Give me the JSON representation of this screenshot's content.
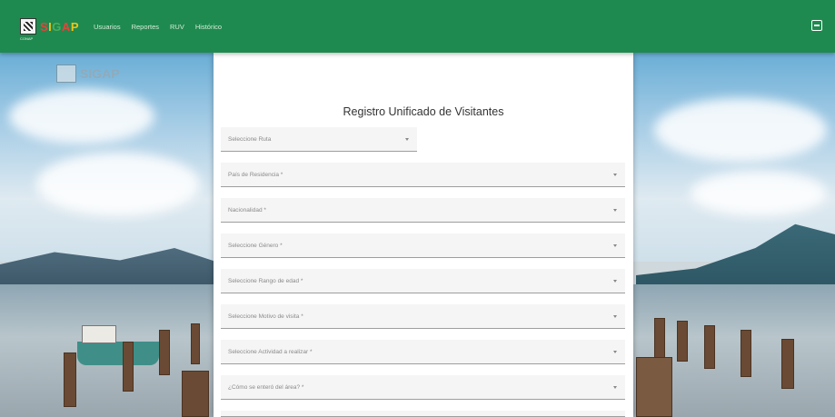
{
  "header": {
    "brand": "SIGAP",
    "subbrand": "CONAP",
    "nav": [
      {
        "label": "Usuarios"
      },
      {
        "label": "Reportes"
      },
      {
        "label": "RUV"
      },
      {
        "label": "Histórico"
      }
    ]
  },
  "background_logo": "SIGAP",
  "form": {
    "title": "Registro Unificado de Visitantes",
    "fields": [
      {
        "label": "Seleccione Ruta"
      },
      {
        "label": "País de Residencia *"
      },
      {
        "label": "Nacionalidad *"
      },
      {
        "label": "Seleccione Género *"
      },
      {
        "label": "Seleccione Rango de edad *"
      },
      {
        "label": "Seleccione Motivo de visita *"
      },
      {
        "label": "Seleccione Actividad a realizar *"
      },
      {
        "label": "¿Cómo se enteró del área? *"
      }
    ]
  },
  "colors": {
    "header": "#1f8a4f",
    "panel": "#ffffff"
  }
}
